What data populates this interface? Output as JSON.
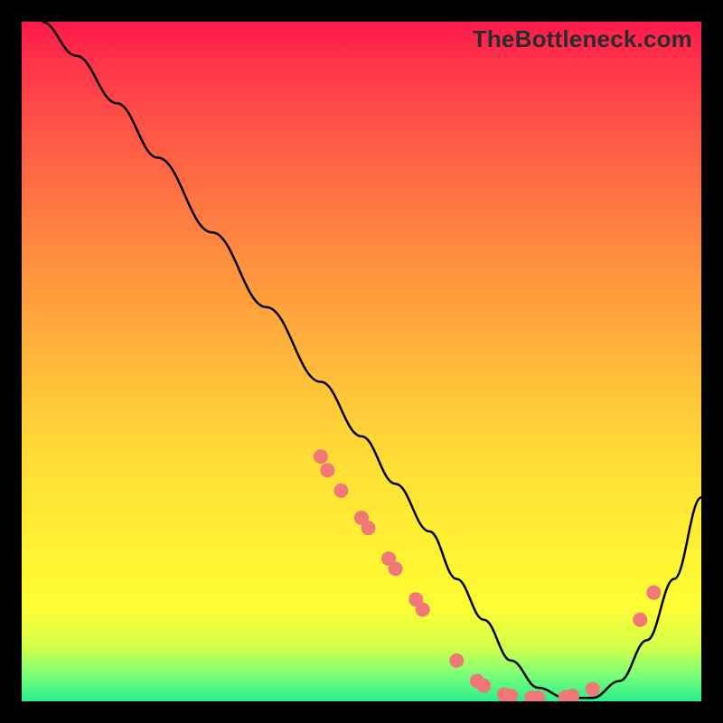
{
  "watermark": "TheBottleneck.com",
  "chart_data": {
    "type": "line",
    "title": "",
    "xlabel": "",
    "ylabel": "",
    "xlim": [
      0,
      100
    ],
    "ylim": [
      0,
      100
    ],
    "grid": false,
    "legend": false,
    "series": [
      {
        "name": "curve",
        "x": [
          3,
          8,
          14,
          20,
          28,
          36,
          44,
          50,
          55,
          60,
          64,
          68,
          72,
          76,
          80,
          84,
          88,
          92,
          96,
          100
        ],
        "y": [
          100,
          95,
          88,
          80,
          69,
          58,
          47,
          39,
          32,
          25,
          18,
          12,
          6,
          2,
          0.5,
          0.5,
          3,
          9,
          18,
          30
        ]
      }
    ],
    "markers": [
      {
        "x": 44,
        "y": 36
      },
      {
        "x": 45,
        "y": 34
      },
      {
        "x": 47,
        "y": 31
      },
      {
        "x": 50,
        "y": 27
      },
      {
        "x": 51,
        "y": 25.5
      },
      {
        "x": 54,
        "y": 21
      },
      {
        "x": 55,
        "y": 19.5
      },
      {
        "x": 58,
        "y": 15
      },
      {
        "x": 59,
        "y": 13.5
      },
      {
        "x": 64,
        "y": 6
      },
      {
        "x": 67,
        "y": 3
      },
      {
        "x": 68,
        "y": 2.3
      },
      {
        "x": 71,
        "y": 1.0
      },
      {
        "x": 72,
        "y": 0.8
      },
      {
        "x": 75,
        "y": 0.5
      },
      {
        "x": 76,
        "y": 0.5
      },
      {
        "x": 80,
        "y": 0.6
      },
      {
        "x": 81,
        "y": 0.8
      },
      {
        "x": 84,
        "y": 1.8
      },
      {
        "x": 91,
        "y": 12
      },
      {
        "x": 93,
        "y": 16
      }
    ],
    "marker_color": "#f07878",
    "line_color": "#000000"
  }
}
